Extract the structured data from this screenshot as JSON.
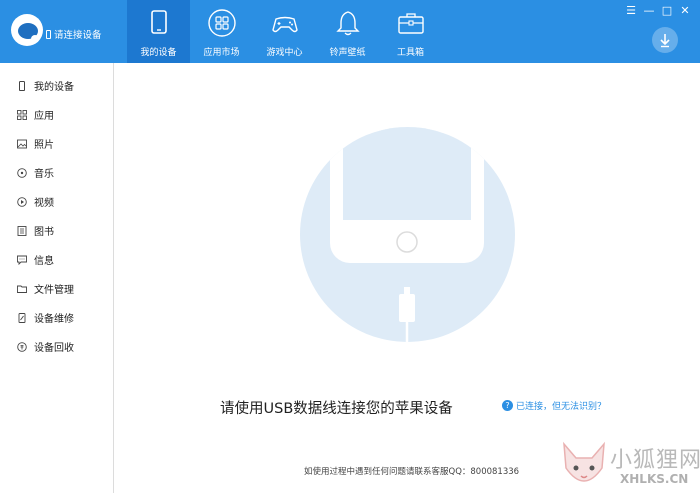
{
  "header": {
    "connection_status": "请连接设备",
    "tabs": [
      {
        "label": "我的设备",
        "icon": "tablet-icon",
        "active": true
      },
      {
        "label": "应用市场",
        "icon": "apps-grid-icon",
        "active": false
      },
      {
        "label": "游戏中心",
        "icon": "gamepad-icon",
        "active": false
      },
      {
        "label": "铃声壁纸",
        "icon": "bell-icon",
        "active": false
      },
      {
        "label": "工具箱",
        "icon": "toolbox-icon",
        "active": false
      }
    ],
    "window_controls": [
      "☰",
      "—",
      "□",
      "✕"
    ]
  },
  "sidebar": {
    "items": [
      {
        "label": "我的设备",
        "icon": "phone-icon"
      },
      {
        "label": "应用",
        "icon": "grid-icon"
      },
      {
        "label": "照片",
        "icon": "image-icon"
      },
      {
        "label": "音乐",
        "icon": "music-icon"
      },
      {
        "label": "视频",
        "icon": "video-icon"
      },
      {
        "label": "图书",
        "icon": "book-icon"
      },
      {
        "label": "信息",
        "icon": "message-icon"
      },
      {
        "label": "文件管理",
        "icon": "folder-icon"
      },
      {
        "label": "设备维修",
        "icon": "repair-icon"
      },
      {
        "label": "设备回收",
        "icon": "recycle-icon"
      }
    ]
  },
  "main": {
    "prompt": "请使用USB数据线连接您的苹果设备",
    "help_link": "已连接，但无法识别？",
    "help_icon": "?",
    "footer_note": "如使用过程中遇到任何问题请联系客服QQ：800081336"
  },
  "watermark": {
    "cn": "小狐狸网",
    "en": "XHLKS.CN"
  },
  "colors": {
    "header": "#2b8fe3",
    "active_tab": "#1d78d0",
    "illustration_bg": "#deebf7"
  }
}
